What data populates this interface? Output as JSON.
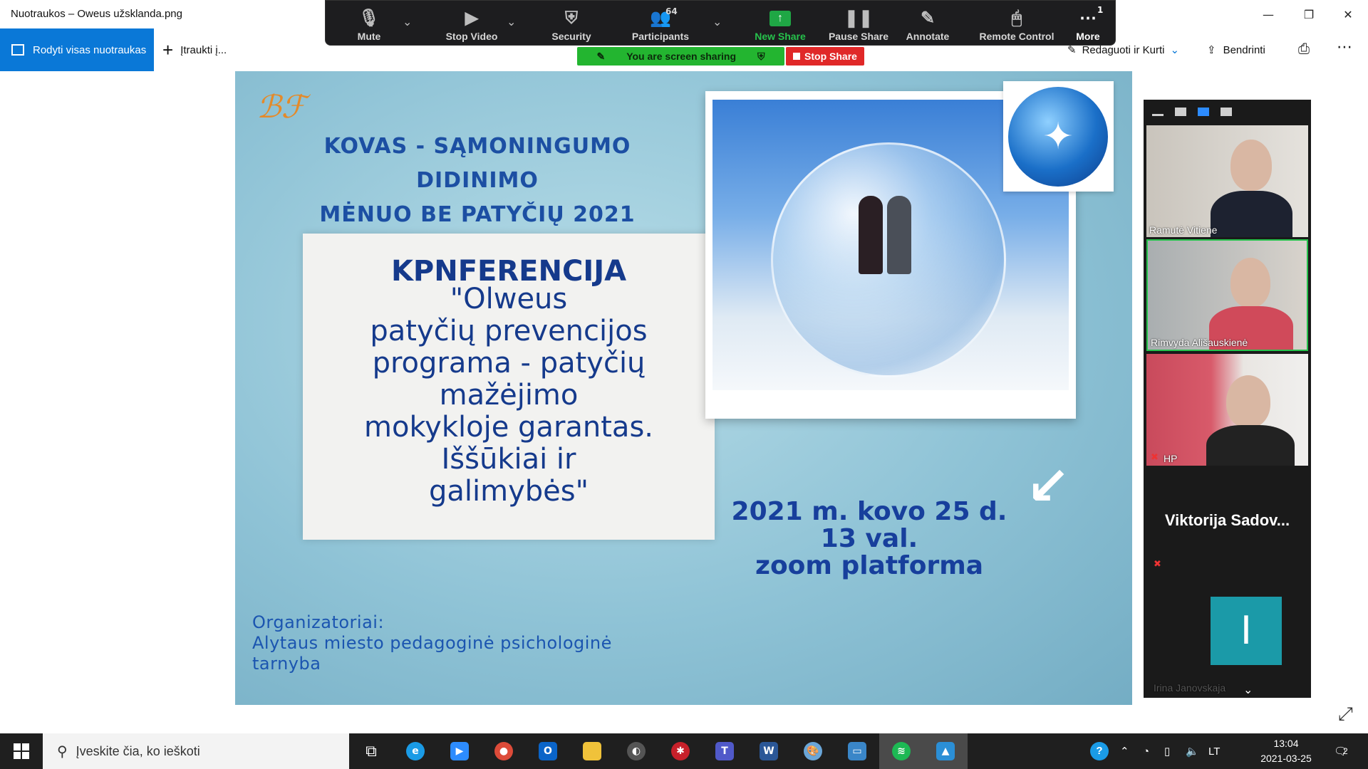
{
  "window": {
    "title": "Nuotraukos – Oweus užsklanda.png",
    "minimize_glyph": "—",
    "maximize_glyph": "❐",
    "close_glyph": "✕"
  },
  "photos_toolbar": {
    "show_all": "Rodyti visas nuotraukas",
    "add": "Įtraukti į...",
    "edit": "Redaguoti ir Kurti",
    "share": "Bendrinti"
  },
  "zoom_toolbar": {
    "mute": "Mute",
    "stop_video": "Stop Video",
    "security": "Security",
    "participants": "Participants",
    "participants_count": "64",
    "new_share": "New Share",
    "pause_share": "Pause Share",
    "annotate": "Annotate",
    "remote_control": "Remote Control",
    "more": "More",
    "more_badge": "1",
    "sharing_status": "You are screen sharing",
    "stop_share": "Stop Share"
  },
  "slide": {
    "heading_line1": "KOVAS - SĄMONINGUMO DIDINIMO",
    "heading_line2": "MĖNUO BE PATYČIŲ 2021",
    "conf_title": "KPNFERENCIJA",
    "conf_lines": [
      "\"Olweus",
      "patyčių prevencijos",
      "programa - patyčių",
      "mažėjimo",
      "mokykloje garantas.",
      "Iššūkiai ir",
      "galimybės\""
    ],
    "date_line1": "2021 m. kovo 25 d.",
    "date_line2": "13 val.",
    "date_line3": "zoom platforma",
    "org_line1": "Organizatoriai:",
    "org_line2": "Alytaus miesto pedagoginė psichologinė",
    "org_line3": "tarnyba"
  },
  "gallery": {
    "participants": [
      {
        "name": "Ramutė Vitiene"
      },
      {
        "name": "Rimvyda Ališauskienė"
      },
      {
        "name": "HP"
      },
      {
        "name": "Viktorija  Sadov..."
      },
      {
        "name": "Irina Janovskaja",
        "initial": "I"
      }
    ]
  },
  "taskbar": {
    "search_placeholder": "Įveskite čia, ko ieškoti",
    "language": "LT",
    "time": "13:04",
    "date": "2021-03-25",
    "notifications": "2"
  },
  "colors": {
    "accent": "#0a78d7",
    "zoom_green": "#23b530",
    "stop_red": "#e02828",
    "slide_blue": "#153a8c"
  }
}
